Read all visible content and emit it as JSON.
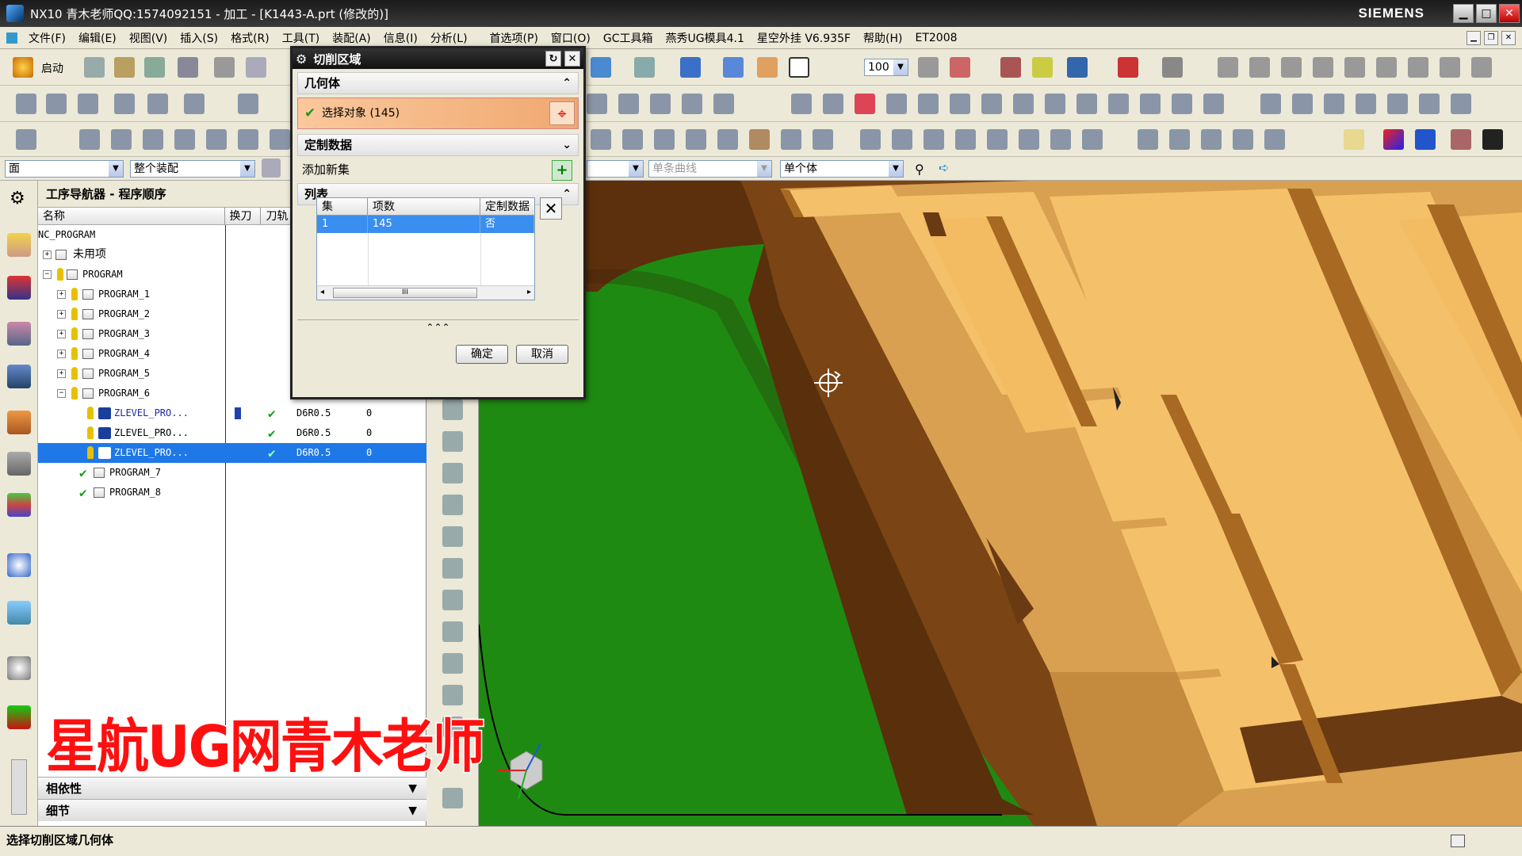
{
  "window": {
    "title": "NX10 青木老师QQ:1574092151 - 加工 - [K1443-A.prt (修改的)]",
    "brand": "SIEMENS",
    "minimize": "▁",
    "maximize": "□",
    "close": "✕"
  },
  "menu": {
    "items": [
      "文件(F)",
      "编辑(E)",
      "视图(V)",
      "插入(S)",
      "格式(R)",
      "工具(T)",
      "装配(A)",
      "信息(I)",
      "分析(L)",
      "首选项(P)",
      "窗口(O)",
      "GC工具箱",
      "燕秀UG模具4.1",
      "星空外挂 V6.935F",
      "帮助(H)",
      "ET2008"
    ]
  },
  "toolbar": {
    "start_label": "启动",
    "zoom_value": "100"
  },
  "selection_bar": {
    "filter": "面",
    "scope": "整个装配",
    "curve_rule": "单条曲线",
    "body_rule": "单个体"
  },
  "navigator": {
    "title": "工序导航器 - 程序顺序",
    "columns": [
      "名称",
      "换刀",
      "刀轨"
    ],
    "rows": [
      {
        "name": "NC_PROGRAM",
        "tool": "",
        "num": ""
      },
      {
        "name": "未用项",
        "tool": "",
        "num": ""
      },
      {
        "name": "PROGRAM",
        "tool": "",
        "num": ""
      },
      {
        "name": "PROGRAM_1",
        "tool": "",
        "num": ""
      },
      {
        "name": "PROGRAM_2",
        "tool": "",
        "num": ""
      },
      {
        "name": "PROGRAM_3",
        "tool": "",
        "num": ""
      },
      {
        "name": "PROGRAM_4",
        "tool": "",
        "num": ""
      },
      {
        "name": "PROGRAM_5",
        "tool": "",
        "num": ""
      },
      {
        "name": "PROGRAM_6",
        "tool": "",
        "num": ""
      },
      {
        "name": "ZLEVEL_PRO...",
        "tool": "D6R0.5",
        "num": "0"
      },
      {
        "name": "ZLEVEL_PRO...",
        "tool": "D6R0.5",
        "num": "0"
      },
      {
        "name": "ZLEVEL_PRO...",
        "tool": "D6R0.5",
        "num": "0"
      },
      {
        "name": "PROGRAM_7",
        "tool": "",
        "num": ""
      },
      {
        "name": "PROGRAM_8",
        "tool": "",
        "num": ""
      }
    ],
    "bottom_panels": [
      "相依性",
      "细节"
    ]
  },
  "watermark": "星航UG网青木老师",
  "dialog": {
    "title": "切削区域",
    "geometry_section": "几何体",
    "select_object": "选择对象 (145)",
    "custom_data_section": "定制数据",
    "add_new_set": "添加新集",
    "list_section": "列表",
    "list_columns": [
      "集",
      "项数",
      "定制数据"
    ],
    "list_rows": [
      {
        "set": "1",
        "count": "145",
        "custom": "否"
      }
    ],
    "scroll_mark": "III",
    "more": "⌃⌃⌃",
    "ok": "确定",
    "cancel": "取消"
  },
  "status": {
    "text": "选择切削区域几何体"
  },
  "colors": {
    "part_top": "#f5c06a",
    "part_side": "#d49a48",
    "wall": "#6a3a12",
    "floor": "#1f8a12",
    "selection": "#1e78e8"
  }
}
